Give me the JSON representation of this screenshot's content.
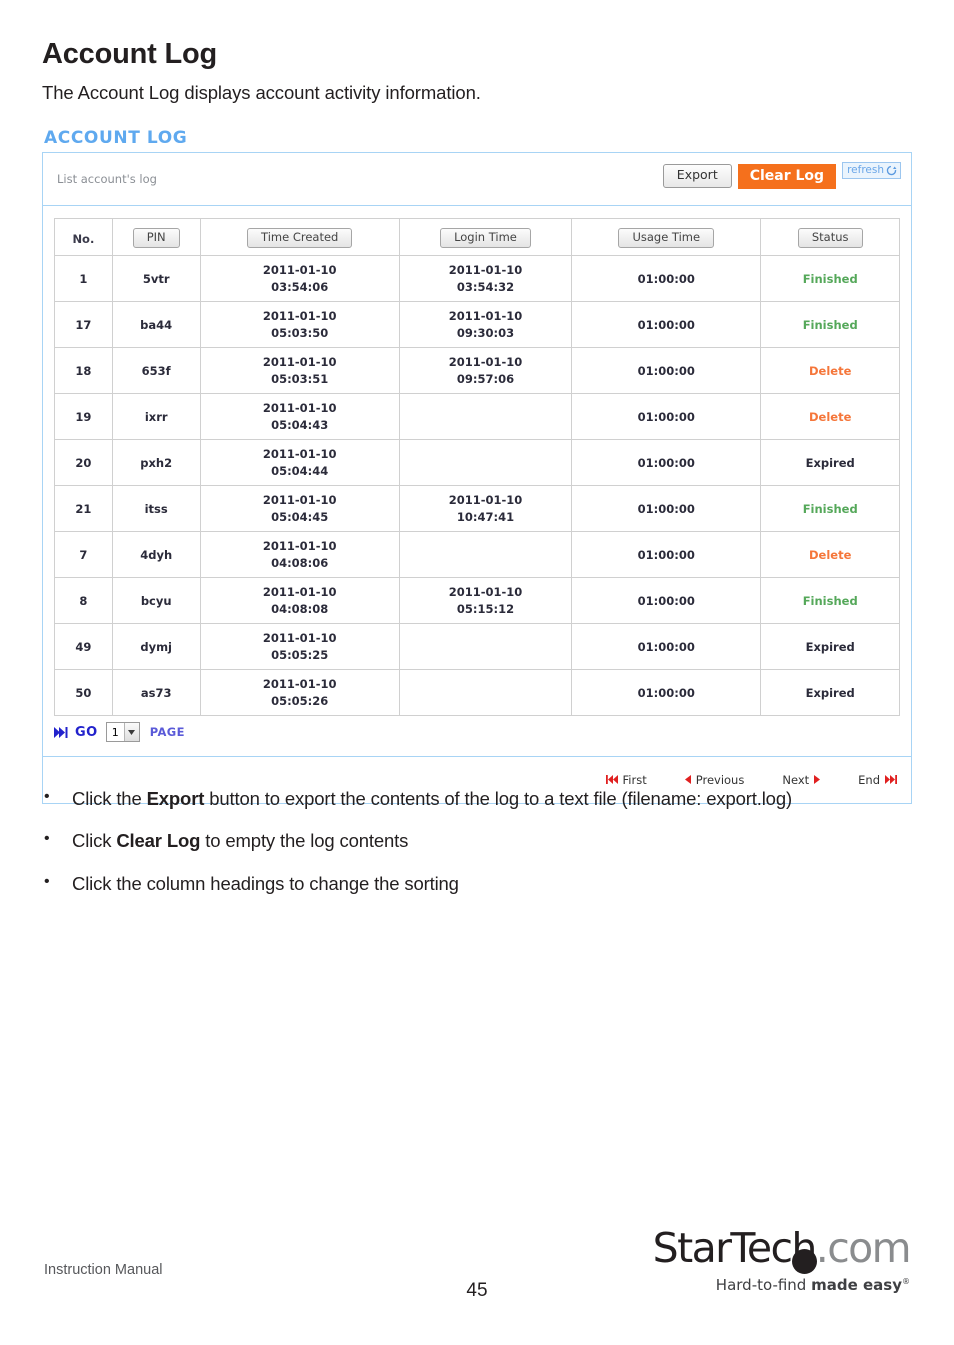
{
  "document": {
    "title": "Account Log",
    "intro": "The Account Log displays account activity information.",
    "bullets": [
      {
        "pre": "Click the ",
        "bold": "Export",
        "post": " button to export the contents of the log to a text file (filename: export.log)"
      },
      {
        "pre": "Click ",
        "bold": "Clear Log",
        "post": " to empty the log contents"
      },
      {
        "pre": "Click the column headings to change the sorting",
        "bold": "",
        "post": ""
      }
    ],
    "footer_left": "Instruction Manual",
    "page_number": "45"
  },
  "logo": {
    "part1": "StarTech",
    "part2": ".com",
    "tagline_light": "Hard-to-find ",
    "tagline_bold": "made easy",
    "tagline_mark": "®"
  },
  "screenshot": {
    "title": "ACCOUNT LOG",
    "toolbar": {
      "caption": "List account's log",
      "export_label": "Export",
      "clear_log_label": "Clear Log",
      "refresh_label": "refresh",
      "refresh_icon": "refresh-circular-arrow-icon"
    },
    "table": {
      "headers": [
        {
          "label": "No.",
          "style": "plain"
        },
        {
          "label": "PIN",
          "style": "button"
        },
        {
          "label": "Time Created",
          "style": "button"
        },
        {
          "label": "Login Time",
          "style": "button"
        },
        {
          "label": "Usage Time",
          "style": "button"
        },
        {
          "label": "Status",
          "style": "button"
        }
      ],
      "rows": [
        {
          "no": "1",
          "pin": "5vtr",
          "created_date": "2011-01-10",
          "created_time": "03:54:06",
          "login_date": "2011-01-10",
          "login_time": "03:54:32",
          "usage": "01:00:00",
          "status": "Finished",
          "status_kind": "finished"
        },
        {
          "no": "17",
          "pin": "ba44",
          "created_date": "2011-01-10",
          "created_time": "05:03:50",
          "login_date": "2011-01-10",
          "login_time": "09:30:03",
          "usage": "01:00:00",
          "status": "Finished",
          "status_kind": "finished"
        },
        {
          "no": "18",
          "pin": "653f",
          "created_date": "2011-01-10",
          "created_time": "05:03:51",
          "login_date": "2011-01-10",
          "login_time": "09:57:06",
          "usage": "01:00:00",
          "status": "Delete",
          "status_kind": "delete"
        },
        {
          "no": "19",
          "pin": "ixrr",
          "created_date": "2011-01-10",
          "created_time": "05:04:43",
          "login_date": "",
          "login_time": "",
          "usage": "01:00:00",
          "status": "Delete",
          "status_kind": "delete"
        },
        {
          "no": "20",
          "pin": "pxh2",
          "created_date": "2011-01-10",
          "created_time": "05:04:44",
          "login_date": "",
          "login_time": "",
          "usage": "01:00:00",
          "status": "Expired",
          "status_kind": "expired"
        },
        {
          "no": "21",
          "pin": "itss",
          "created_date": "2011-01-10",
          "created_time": "05:04:45",
          "login_date": "2011-01-10",
          "login_time": "10:47:41",
          "usage": "01:00:00",
          "status": "Finished",
          "status_kind": "finished"
        },
        {
          "no": "7",
          "pin": "4dyh",
          "created_date": "2011-01-10",
          "created_time": "04:08:06",
          "login_date": "",
          "login_time": "",
          "usage": "01:00:00",
          "status": "Delete",
          "status_kind": "delete"
        },
        {
          "no": "8",
          "pin": "bcyu",
          "created_date": "2011-01-10",
          "created_time": "04:08:08",
          "login_date": "2011-01-10",
          "login_time": "05:15:12",
          "usage": "01:00:00",
          "status": "Finished",
          "status_kind": "finished"
        },
        {
          "no": "49",
          "pin": "dymj",
          "created_date": "2011-01-10",
          "created_time": "05:05:25",
          "login_date": "",
          "login_time": "",
          "usage": "01:00:00",
          "status": "Expired",
          "status_kind": "expired"
        },
        {
          "no": "50",
          "pin": "as73",
          "created_date": "2011-01-10",
          "created_time": "05:05:26",
          "login_date": "",
          "login_time": "",
          "usage": "01:00:00",
          "status": "Expired",
          "status_kind": "expired"
        }
      ]
    },
    "pager": {
      "go_label": "GO",
      "go_icon": "skip-forward-icon",
      "page_value": "1",
      "page_label": "PAGE",
      "dropdown_icon": "chevron-down-icon"
    },
    "nav": [
      {
        "label": "First",
        "icon": "skip-backward-icon",
        "icon_side": "left"
      },
      {
        "label": "Previous",
        "icon": "triangle-left-icon",
        "icon_side": "left"
      },
      {
        "label": "Next",
        "icon": "triangle-right-icon",
        "icon_side": "right"
      },
      {
        "label": "End",
        "icon": "skip-forward-icon",
        "icon_side": "right"
      }
    ]
  },
  "colors": {
    "panel_border": "#a8d4f5",
    "shot_title": "#5fa9ef",
    "clear_log_bg": "#f5701c",
    "status_finished": "#55a85a",
    "status_delete": "#f5763a",
    "pager_blue": "#2222cc",
    "nav_red": "#e02020"
  }
}
